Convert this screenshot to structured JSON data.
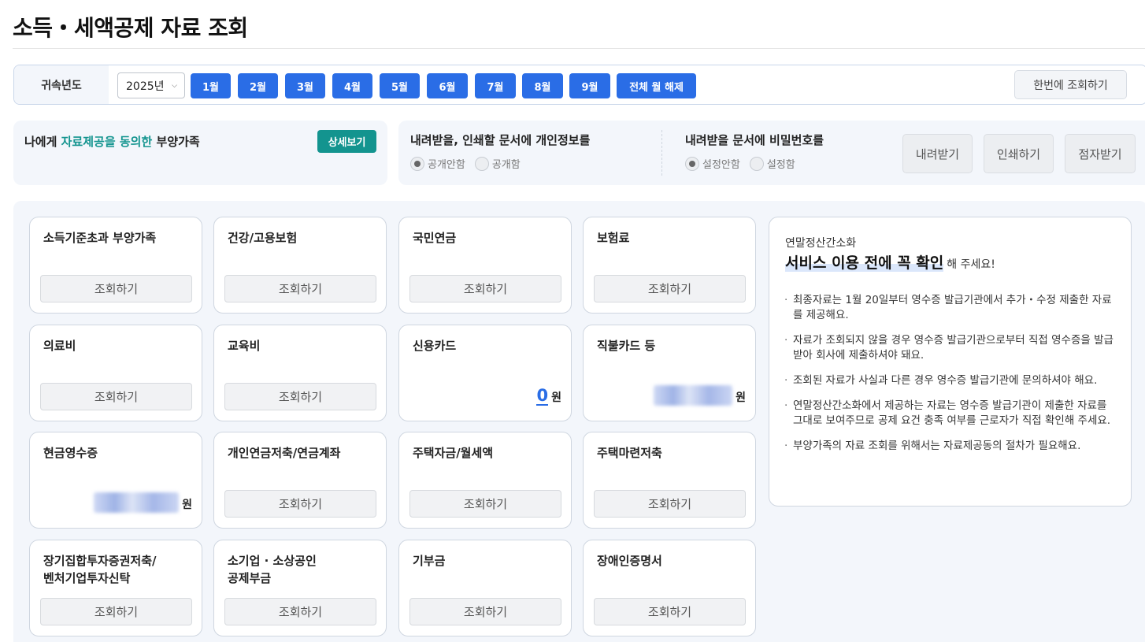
{
  "page": {
    "title": "소득・세액공제 자료 조회"
  },
  "year_bar": {
    "label": "귀속년도",
    "year_value": "2025년",
    "months": [
      "1월",
      "2월",
      "3월",
      "4월",
      "5월",
      "6월",
      "7월",
      "8월",
      "9월"
    ],
    "clear_label": "전체 월 해제",
    "bulk_label": "한번에 조회하기"
  },
  "dependents": {
    "prefix": "나에게 ",
    "highlight": "자료제공을 동의한",
    "suffix": " 부양가족",
    "detail_label": "상세보기"
  },
  "document_options": {
    "personal": {
      "title": "내려받을, 인쇄할 문서에 개인정보를",
      "options": [
        "공개안함",
        "공개함"
      ],
      "selected": "공개안함"
    },
    "password": {
      "title": "내려받을 문서에 비밀번호를",
      "options": [
        "설정안함",
        "설정함"
      ],
      "selected": "설정안함"
    },
    "actions": [
      "내려받기",
      "인쇄하기",
      "점자받기"
    ]
  },
  "cards": [
    {
      "title": "소득기준초과 부양가족",
      "button": "조회하기"
    },
    {
      "title": "건강/고용보험",
      "button": "조회하기"
    },
    {
      "title": "국민연금",
      "button": "조회하기"
    },
    {
      "title": "보험료",
      "button": "조회하기"
    },
    {
      "title": "의료비",
      "button": "조회하기"
    },
    {
      "title": "교육비",
      "button": "조회하기"
    },
    {
      "title": "신용카드",
      "amount": "0",
      "unit": "원"
    },
    {
      "title": "직불카드 등",
      "amount_hidden": true,
      "unit": "원"
    },
    {
      "title": "현금영수증",
      "amount_hidden": true,
      "unit": "원"
    },
    {
      "title": "개인연금저축/연금계좌",
      "button": "조회하기"
    },
    {
      "title": "주택자금/월세액",
      "button": "조회하기"
    },
    {
      "title": "주택마련저축",
      "button": "조회하기"
    },
    {
      "title": "장기집합투자증권저축/\n벤처기업투자신탁",
      "button": "조회하기"
    },
    {
      "title": "소기업 · 소상공인\n공제부금",
      "button": "조회하기"
    },
    {
      "title": "기부금",
      "button": "조회하기"
    },
    {
      "title": "장애인증명서",
      "button": "조회하기"
    }
  ],
  "notice": {
    "subtitle": "연말정산간소화",
    "headline": "서비스 이용 전에 꼭 확인",
    "headline_suffix": "해 주세요!",
    "items": [
      "최종자료는 1월 20일부터 영수증 발급기관에서 추가・수정 제출한 자료를 제공해요.",
      "자료가 조회되지 않을 경우 영수증 발급기관으로부터 직접 영수증을 발급받아 회사에 제출하셔야 돼요.",
      "조회된 자료가 사실과 다른 경우 영수증 발급기관에 문의하셔야 해요.",
      "연말정산간소화에서 제공하는 자료는 영수증 발급기관이 제출한 자료를 그대로 보여주므로 공제 요건 충족 여부를 근로자가 직접 확인해 주세요.",
      "부양가족의 자료 조회를 위해서는 자료제공동의 절차가 필요해요."
    ]
  },
  "colors": {
    "primary": "#2a6de6",
    "teal": "#13948f",
    "panel_bg": "#f3f6fb"
  },
  "icons": {
    "year_dropdown": "chevron-down-icon"
  }
}
